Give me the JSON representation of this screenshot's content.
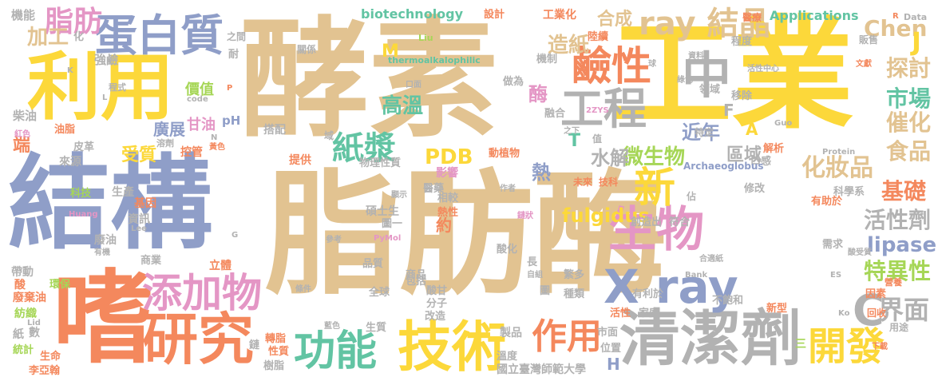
{
  "palette": {
    "tan": "#e2c391",
    "gold": "#fcd83a",
    "blue": "#8f9ec8",
    "orange": "#f4885d",
    "green": "#62c4a3",
    "gray": "#b2b2b2",
    "pink": "#e496c5",
    "lime": "#a6d657"
  },
  "words": [
    {
      "text": "脂肪酶",
      "color": "tan",
      "vertical": false
    },
    {
      "text": "酵素",
      "color": "tan",
      "vertical": false
    },
    {
      "text": "工業",
      "color": "gold",
      "vertical": false
    },
    {
      "text": "結構",
      "color": "blue",
      "vertical": false
    },
    {
      "text": "利用",
      "color": "gold",
      "vertical": false
    },
    {
      "text": "嗜",
      "color": "orange",
      "vertical": false
    },
    {
      "text": "蛋白質",
      "color": "blue",
      "vertical": false
    },
    {
      "text": "研究",
      "color": "orange",
      "vertical": false
    },
    {
      "text": "技術",
      "color": "gold",
      "vertical": false
    },
    {
      "text": "清潔劑",
      "color": "gray",
      "vertical": false
    },
    {
      "text": "功能",
      "color": "green",
      "vertical": false
    },
    {
      "text": "添加物",
      "color": "pink",
      "vertical": false
    },
    {
      "text": "生物",
      "color": "pink",
      "vertical": false
    },
    {
      "text": "X ray",
      "color": "blue",
      "vertical": false
    },
    {
      "text": "工程",
      "color": "gray",
      "vertical": false
    },
    {
      "text": "鹼性",
      "color": "orange",
      "vertical": false
    },
    {
      "text": "中",
      "color": "gray",
      "vertical": false
    },
    {
      "text": "ray 結晶",
      "color": "tan",
      "vertical": false
    },
    {
      "text": "開發",
      "color": "gold",
      "vertical": false
    },
    {
      "text": "作用",
      "color": "orange",
      "vertical": false
    },
    {
      "text": "新",
      "color": "gold",
      "vertical": false
    },
    {
      "text": "脂肪",
      "color": "pink",
      "vertical": false
    },
    {
      "text": "紙漿",
      "color": "green",
      "vertical": false
    },
    {
      "text": "C",
      "color": "gray",
      "vertical": false
    },
    {
      "text": "界面",
      "color": "gray",
      "vertical": false
    },
    {
      "text": "化妝品",
      "color": "tan",
      "vertical": false
    },
    {
      "text": "基礎",
      "color": "orange",
      "vertical": false
    },
    {
      "text": "活性劑",
      "color": "gray",
      "vertical": false
    },
    {
      "text": "特異性",
      "color": "lime",
      "vertical": false
    },
    {
      "text": "催化",
      "color": "tan",
      "vertical": false
    },
    {
      "text": "食品",
      "color": "tan",
      "vertical": false
    },
    {
      "text": "市場",
      "color": "green",
      "vertical": false
    },
    {
      "text": "探討",
      "color": "tan",
      "vertical": false
    },
    {
      "text": "lipase",
      "color": "blue",
      "vertical": false
    },
    {
      "text": "Chen",
      "color": "tan",
      "vertical": false
    },
    {
      "text": "J",
      "color": "gold",
      "vertical": false
    },
    {
      "text": "Applications",
      "color": "green",
      "vertical": false
    },
    {
      "text": "合成",
      "color": "tan",
      "vertical": false
    },
    {
      "text": "造紙",
      "color": "tan",
      "vertical": false
    },
    {
      "text": "加工",
      "color": "tan",
      "vertical": false
    },
    {
      "text": "高溫",
      "color": "green",
      "vertical": false
    },
    {
      "text": "酶",
      "color": "pink",
      "vertical": false
    },
    {
      "text": "近年",
      "color": "blue",
      "vertical": false
    },
    {
      "text": "微生物",
      "color": "lime",
      "vertical": false
    },
    {
      "text": "水解",
      "color": "gray",
      "vertical": false
    },
    {
      "text": "區域",
      "color": "gray",
      "vertical": false
    },
    {
      "text": "PDB",
      "color": "gold",
      "vertical": false
    },
    {
      "text": "受質",
      "color": "gold",
      "vertical": false
    },
    {
      "text": "熱",
      "color": "blue",
      "vertical": false
    },
    {
      "text": "fulgidus",
      "color": "gold",
      "vertical": false
    },
    {
      "text": "biotechnology",
      "color": "green",
      "vertical": false
    },
    {
      "text": "廣展",
      "color": "blue",
      "vertical": false
    },
    {
      "text": "甘油",
      "color": "pink",
      "vertical": false
    },
    {
      "text": "M",
      "color": "gold",
      "vertical": false
    },
    {
      "text": "T",
      "color": "green",
      "vertical": false
    },
    {
      "text": "A",
      "color": "gold",
      "vertical": false
    },
    {
      "text": "F",
      "color": "gray",
      "vertical": false
    },
    {
      "text": "H",
      "color": "blue",
      "vertical": false
    },
    {
      "text": "約",
      "color": "orange",
      "vertical": false
    },
    {
      "text": "機能",
      "color": "gray",
      "vertical": false
    },
    {
      "text": "強鹼",
      "color": "gray",
      "vertical": false
    },
    {
      "text": "價值",
      "color": "lime",
      "vertical": false
    },
    {
      "text": "柴油",
      "color": "gray",
      "vertical": false
    },
    {
      "text": "生產",
      "color": "gray",
      "vertical": false
    },
    {
      "text": "來源",
      "color": "gray",
      "vertical": false
    },
    {
      "text": "科技",
      "color": "lime",
      "vertical": false
    },
    {
      "text": "基因",
      "color": "orange",
      "vertical": false
    },
    {
      "text": "資訊",
      "color": "gray",
      "vertical": false
    },
    {
      "text": "端",
      "color": "orange",
      "vertical": false
    },
    {
      "text": "控管",
      "color": "orange",
      "vertical": false
    },
    {
      "text": "提供",
      "color": "orange",
      "vertical": false
    },
    {
      "text": "搭配",
      "color": "gray",
      "vertical": false
    },
    {
      "text": "物理性質",
      "color": "gray",
      "vertical": false
    },
    {
      "text": "碩士生",
      "color": "gray",
      "vertical": false
    },
    {
      "text": "相較",
      "color": "gray",
      "vertical": false
    },
    {
      "text": "熱性",
      "color": "orange",
      "vertical": false
    },
    {
      "text": "醫藥",
      "color": "gray",
      "vertical": false
    },
    {
      "text": "影響",
      "color": "pink",
      "vertical": false
    },
    {
      "text": "動植物",
      "color": "orange",
      "vertical": false
    },
    {
      "text": "設計",
      "color": "orange",
      "vertical": false
    },
    {
      "text": "工業化",
      "color": "orange",
      "vertical": false
    },
    {
      "text": "醫療",
      "color": "orange",
      "vertical": false
    },
    {
      "text": "Data",
      "color": "gray",
      "vertical": false
    },
    {
      "text": "販售",
      "color": "gray",
      "vertical": false
    },
    {
      "text": "程度",
      "color": "gray",
      "vertical": false
    },
    {
      "text": "機制",
      "color": "gray",
      "vertical": false
    },
    {
      "text": "陸續",
      "color": "orange",
      "vertical": false
    },
    {
      "text": "做為",
      "color": "gray",
      "vertical": false
    },
    {
      "text": "融合",
      "color": "gray",
      "vertical": false
    },
    {
      "text": "領域",
      "color": "gray",
      "vertical": false
    },
    {
      "text": "移除",
      "color": "gray",
      "vertical": false
    },
    {
      "text": "特定",
      "color": "gray",
      "vertical": false
    },
    {
      "text": "解析",
      "color": "orange",
      "vertical": false
    },
    {
      "text": "口感",
      "color": "gray",
      "vertical": false
    },
    {
      "text": "科學系",
      "color": "gray",
      "vertical": false
    },
    {
      "text": "修改",
      "color": "gray",
      "vertical": false
    },
    {
      "text": "有助於",
      "color": "orange",
      "vertical": false
    },
    {
      "text": "創造出",
      "color": "gray",
      "vertical": false
    },
    {
      "text": "符合",
      "color": "gray",
      "vertical": false
    },
    {
      "text": "需求",
      "color": "gray",
      "vertical": false
    },
    {
      "text": "營養",
      "color": "orange",
      "vertical": false
    },
    {
      "text": "因素",
      "color": "orange",
      "vertical": false
    },
    {
      "text": "用途",
      "color": "gray",
      "vertical": false
    },
    {
      "text": "繁多",
      "color": "gray",
      "vertical": false
    },
    {
      "text": "種類",
      "color": "gray",
      "vertical": false
    },
    {
      "text": "有利於",
      "color": "gray",
      "vertical": false
    },
    {
      "text": "不飽和",
      "color": "gray",
      "vertical": false
    },
    {
      "text": "新型",
      "color": "orange",
      "vertical": false
    },
    {
      "text": "商品",
      "color": "gray",
      "vertical": false
    },
    {
      "text": "酸甘",
      "color": "gray",
      "vertical": false
    },
    {
      "text": "分子",
      "color": "gray",
      "vertical": false
    },
    {
      "text": "包括",
      "color": "gray",
      "vertical": false
    },
    {
      "text": "全球",
      "color": "gray",
      "vertical": false
    },
    {
      "text": "改造",
      "color": "gray",
      "vertical": false
    },
    {
      "text": "品質",
      "color": "gray",
      "vertical": false
    },
    {
      "text": "生質",
      "color": "gray",
      "vertical": false
    },
    {
      "text": "製品",
      "color": "gray",
      "vertical": false
    },
    {
      "text": "市面",
      "color": "gray",
      "vertical": false
    },
    {
      "text": "位置",
      "color": "gray",
      "vertical": false
    },
    {
      "text": "溫度",
      "color": "gray",
      "vertical": false
    },
    {
      "text": "國立臺灣師範大學",
      "color": "gray",
      "vertical": false
    },
    {
      "text": "活性",
      "color": "orange",
      "vertical": false
    },
    {
      "text": "家庭",
      "color": "gray",
      "vertical": false
    },
    {
      "text": "廢油",
      "color": "gray",
      "vertical": false
    },
    {
      "text": "商業",
      "color": "gray",
      "vertical": false
    },
    {
      "text": "立體",
      "color": "orange",
      "vertical": false
    },
    {
      "text": "帶動",
      "color": "gray",
      "vertical": false
    },
    {
      "text": "環保",
      "color": "lime",
      "vertical": false
    },
    {
      "text": "廢棄油",
      "color": "orange",
      "vertical": false
    },
    {
      "text": "紡織",
      "color": "lime",
      "vertical": false
    },
    {
      "text": "數",
      "color": "gray",
      "vertical": false
    },
    {
      "text": "紙",
      "color": "gray",
      "vertical": false
    },
    {
      "text": "統計",
      "color": "lime",
      "vertical": false
    },
    {
      "text": "生命",
      "color": "orange",
      "vertical": false
    },
    {
      "text": "李亞翰",
      "color": "orange",
      "vertical": false
    },
    {
      "text": "轉脂",
      "color": "orange",
      "vertical": false
    },
    {
      "text": "性質",
      "color": "orange",
      "vertical": false
    },
    {
      "text": "鏈",
      "color": "gray",
      "vertical": false
    },
    {
      "text": "樹脂",
      "color": "gray",
      "vertical": false
    },
    {
      "text": "皮革",
      "color": "gray",
      "vertical": false
    },
    {
      "text": "油脂",
      "color": "orange",
      "vertical": false
    },
    {
      "text": "pH",
      "color": "blue",
      "vertical": false
    },
    {
      "text": "之間",
      "color": "gray",
      "vertical": false
    },
    {
      "text": "關係",
      "color": "gray",
      "vertical": false
    },
    {
      "text": "Liu",
      "color": "lime",
      "vertical": false
    },
    {
      "text": "thermoalkalophilic",
      "color": "green",
      "vertical": false
    },
    {
      "text": "Protein",
      "color": "gray",
      "vertical": false
    },
    {
      "text": "Guo",
      "color": "gray",
      "vertical": false
    },
    {
      "text": "Archaeoglobus",
      "color": "blue",
      "vertical": false
    },
    {
      "text": "2ZYS",
      "color": "pink",
      "vertical": false
    },
    {
      "text": "PyMol",
      "color": "pink",
      "vertical": false
    },
    {
      "text": "Huang",
      "color": "pink",
      "vertical": false
    },
    {
      "text": "Lee",
      "color": "gray",
      "vertical": false
    },
    {
      "text": "Bank",
      "color": "gray",
      "vertical": false
    },
    {
      "text": "code",
      "color": "gray",
      "vertical": false
    },
    {
      "text": "耐",
      "color": "gray",
      "vertical": false
    },
    {
      "text": "化",
      "color": "gray",
      "vertical": false
    },
    {
      "text": "圖一",
      "color": "gray",
      "vertical": false
    },
    {
      "text": "酸化",
      "color": "gray",
      "vertical": false
    },
    {
      "text": "長",
      "color": "gray",
      "vertical": false
    },
    {
      "text": "圖",
      "color": "gray",
      "vertical": false
    },
    {
      "text": "程式",
      "color": "gray",
      "vertical": false
    },
    {
      "text": "紅色",
      "color": "pink",
      "vertical": false
    },
    {
      "text": "黃色",
      "color": "orange",
      "vertical": false
    },
    {
      "text": "藍色",
      "color": "gray",
      "vertical": false
    },
    {
      "text": "綠色",
      "color": "gray",
      "vertical": false
    },
    {
      "text": "活性中心",
      "color": "gray",
      "vertical": false
    },
    {
      "text": "溶劑",
      "color": "gray",
      "vertical": false
    },
    {
      "text": "文獻",
      "color": "orange",
      "vertical": false
    },
    {
      "text": "資料",
      "color": "gray",
      "vertical": false
    },
    {
      "text": "未來",
      "color": "orange",
      "vertical": false
    },
    {
      "text": "技科",
      "color": "orange",
      "vertical": false
    },
    {
      "text": "值",
      "color": "gray",
      "vertical": false
    },
    {
      "text": "佔",
      "color": "gray",
      "vertical": false
    },
    {
      "text": "參考",
      "color": "gray",
      "vertical": false
    },
    {
      "text": "顯示",
      "color": "gray",
      "vertical": false
    },
    {
      "text": "作者",
      "color": "gray",
      "vertical": false
    },
    {
      "text": "酸受質",
      "color": "gray",
      "vertical": false
    },
    {
      "text": "合適紙",
      "color": "gray",
      "vertical": false
    },
    {
      "text": "下載",
      "color": "orange",
      "vertical": false
    },
    {
      "text": "自組",
      "color": "gray",
      "vertical": false
    },
    {
      "text": "條件",
      "color": "gray",
      "vertical": false
    },
    {
      "text": "回收",
      "color": "orange",
      "vertical": false
    },
    {
      "text": "有機",
      "color": "gray",
      "vertical": false
    },
    {
      "text": "口面",
      "color": "gray",
      "vertical": false
    },
    {
      "text": "鏈狀",
      "color": "pink",
      "vertical": false
    },
    {
      "text": "之下",
      "color": "gray",
      "vertical": false
    },
    {
      "text": "域",
      "color": "gray",
      "vertical": false
    },
    {
      "text": "球",
      "color": "gray",
      "vertical": false
    },
    {
      "text": "酸",
      "color": "orange",
      "vertical": false
    },
    {
      "text": "K",
      "color": "gray",
      "vertical": false
    },
    {
      "text": "L",
      "color": "gray",
      "vertical": false
    },
    {
      "text": "P",
      "color": "orange",
      "vertical": false
    },
    {
      "text": "N",
      "color": "gray",
      "vertical": false
    },
    {
      "text": "G",
      "color": "gray",
      "vertical": false
    },
    {
      "text": "R",
      "color": "orange",
      "vertical": false
    },
    {
      "text": "Lid",
      "color": "gray",
      "vertical": false
    },
    {
      "text": "Ko",
      "color": "gray",
      "vertical": false
    },
    {
      "text": "ES",
      "color": "gray",
      "vertical": false
    },
    {
      "text": "三",
      "color": "lime",
      "vertical": false
    }
  ]
}
